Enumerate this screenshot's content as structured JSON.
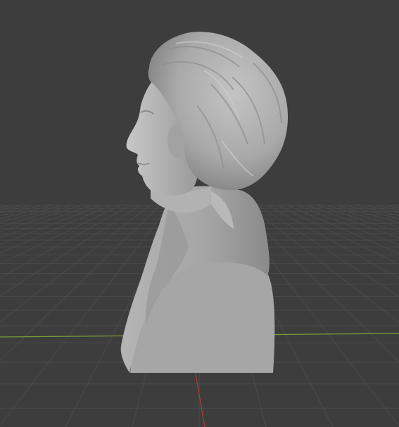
{
  "viewport": {
    "background": "#3d3d3d",
    "grid_color": "#4a4a4a",
    "axis_x_color": "#7a9a3a",
    "axis_y_color": "#b33a3a",
    "model_color": "#a8a8a8"
  }
}
